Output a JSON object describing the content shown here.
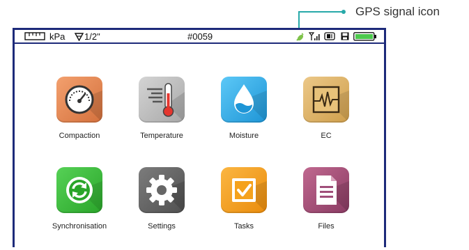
{
  "annotation": {
    "label": "GPS signal icon",
    "color": "#27a9a9"
  },
  "status_bar": {
    "unit": "kPa",
    "probe": "1/2\"",
    "device_id": "#0059",
    "icons": [
      "ruler-icon",
      "probe-cone-icon",
      "gps-signal-icon",
      "cellular-signal-icon",
      "sd-card-icon",
      "save-icon",
      "battery-icon"
    ],
    "gps_color": "#7ec24a",
    "battery_color": "#4cc94c"
  },
  "apps": [
    {
      "label": "Compaction",
      "icon": "gauge-icon",
      "color": "#e88a55"
    },
    {
      "label": "Temperature",
      "icon": "thermometer-icon",
      "color": "#b9b9b9"
    },
    {
      "label": "Moisture",
      "icon": "water-drop-icon",
      "color": "#2aa9e6"
    },
    {
      "label": "EC",
      "icon": "ec-waveform-icon",
      "color": "#e0b769"
    },
    {
      "label": "Synchronisation",
      "icon": "sync-icon",
      "color": "#3fbf3f"
    },
    {
      "label": "Settings",
      "icon": "gear-icon",
      "color": "#6e6e6e"
    },
    {
      "label": "Tasks",
      "icon": "checkbox-icon",
      "color": "#f5a21c"
    },
    {
      "label": "Files",
      "icon": "document-icon",
      "color": "#a04f7a"
    }
  ]
}
